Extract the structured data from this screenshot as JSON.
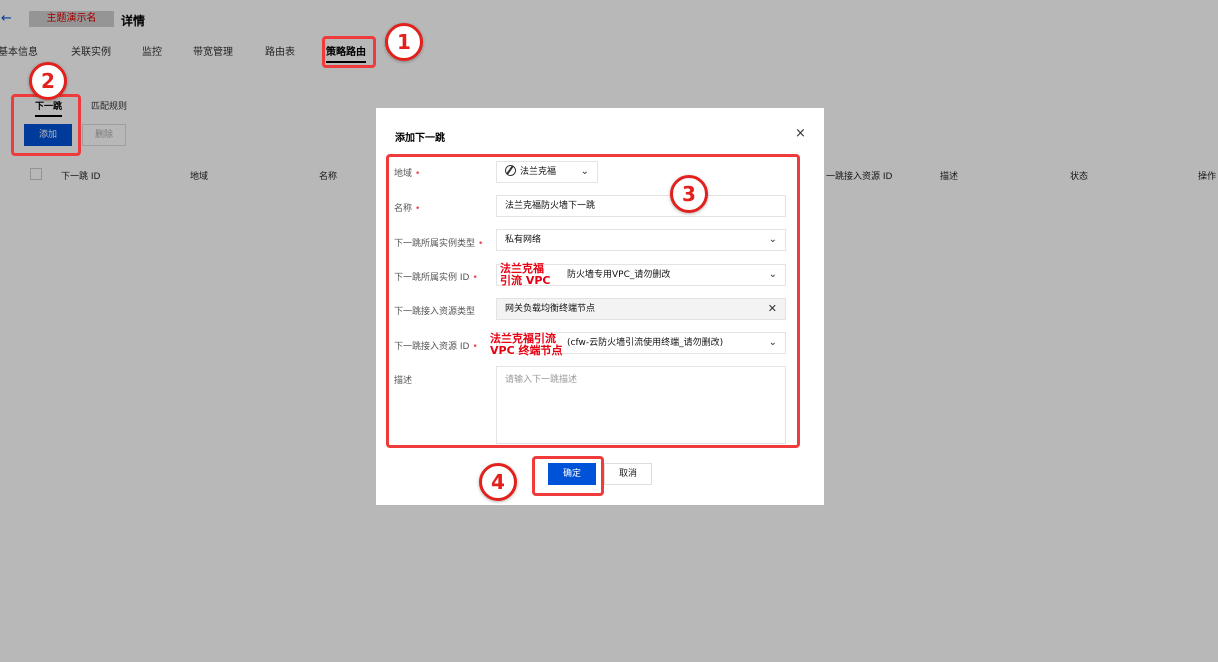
{
  "header": {
    "back_icon": "arrow-left-icon",
    "redacted_name": "主题演示名",
    "title": "详情"
  },
  "top_tabs": [
    {
      "label": "基本信息"
    },
    {
      "label": "关联实例"
    },
    {
      "label": "监控"
    },
    {
      "label": "带宽管理"
    },
    {
      "label": "路由表"
    },
    {
      "label": "策略路由",
      "active": true
    }
  ],
  "sub_tabs": [
    {
      "label": "下一跳",
      "active": true
    },
    {
      "label": "匹配规则"
    }
  ],
  "toolbar": {
    "add_label": "添加",
    "delete_label": "删除"
  },
  "table": {
    "columns": [
      "下一跳 ID",
      "地域",
      "名称",
      "一跳接入资源 ID",
      "描述",
      "状态",
      "操作"
    ]
  },
  "modal": {
    "title": "添加下一跳",
    "close_icon": "close-icon",
    "fields": {
      "region": {
        "label": "地域",
        "required": true,
        "value": "法兰克福"
      },
      "name": {
        "label": "名称",
        "required": true,
        "value": "法兰克福防火墙下一跳"
      },
      "instance_type": {
        "label": "下一跳所属实例类型",
        "required": true,
        "value": "私有网络"
      },
      "instance_id": {
        "label": "下一跳所属实例 ID",
        "required": true,
        "value": "防火墙专用VPC_请勿删改",
        "annotation_line1": "法兰克福",
        "annotation_line2": "引流 VPC"
      },
      "resource_type": {
        "label": "下一跳接入资源类型",
        "required": false,
        "value": "网关负载均衡终端节点"
      },
      "resource_id": {
        "label": "下一跳接入资源 ID",
        "required": true,
        "value": "(cfw-云防火墙引流使用终端_请勿删改)",
        "annotation_line1": "法兰克福引流",
        "annotation_line2": "VPC 终端节点"
      },
      "description": {
        "label": "描述",
        "required": false,
        "placeholder": "请输入下一跳描述"
      }
    },
    "ok_label": "确定",
    "cancel_label": "取消"
  },
  "annotations": {
    "badge1": "1",
    "badge2": "2",
    "badge3": "3",
    "badge4": "4",
    "highlight_color": "#ef3b3b"
  },
  "colors": {
    "primary": "#0052d9",
    "required": "#e34d59",
    "annotation_red": "#e60012"
  }
}
